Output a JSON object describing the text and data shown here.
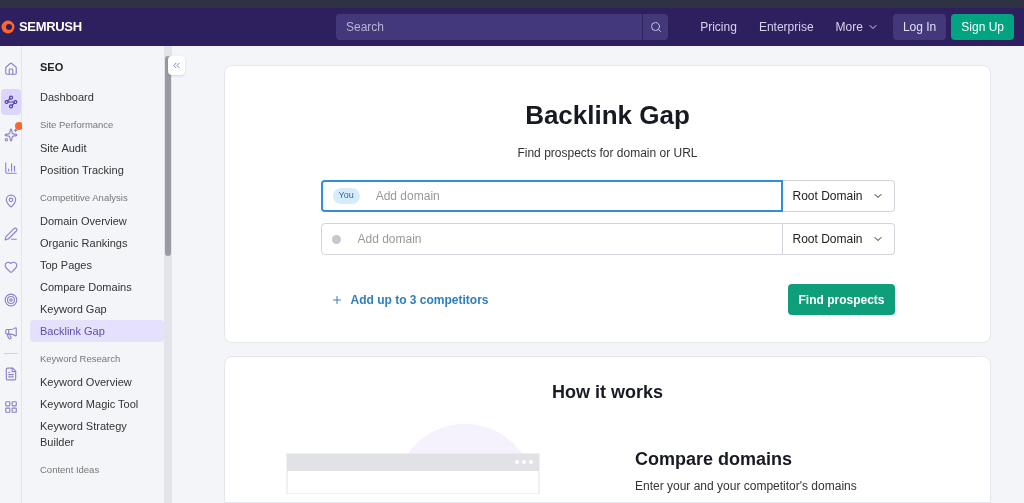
{
  "header": {
    "logo": "SEMRUSH",
    "search": {
      "placeholder": "Search"
    },
    "nav": [
      {
        "label": "Pricing",
        "kind": "link"
      },
      {
        "label": "Enterprise",
        "kind": "link"
      },
      {
        "label": "More",
        "kind": "dropdown"
      }
    ],
    "login": "Log In",
    "signup": "Sign Up"
  },
  "rail": [
    {
      "kind": "home",
      "selected": false
    },
    {
      "kind": "seo",
      "selected": true
    },
    {
      "kind": "sparkle",
      "selected": false,
      "badge": true
    },
    {
      "kind": "chart",
      "selected": false
    },
    {
      "kind": "pin",
      "selected": false
    },
    {
      "kind": "pen",
      "selected": false
    },
    {
      "kind": "heart",
      "selected": false
    },
    {
      "kind": "target",
      "selected": false
    },
    {
      "kind": "megaphone",
      "selected": false
    },
    {
      "kind": "divider"
    },
    {
      "kind": "doc",
      "selected": false
    },
    {
      "kind": "grid",
      "selected": false
    }
  ],
  "sidebar": {
    "title": "SEO",
    "sections": [
      {
        "items": [
          {
            "label": "Dashboard",
            "selected": false
          }
        ]
      },
      {
        "heading": "Site Performance",
        "items": [
          {
            "label": "Site Audit",
            "selected": false
          },
          {
            "label": "Position Tracking",
            "selected": false
          }
        ]
      },
      {
        "heading": "Competitive Analysis",
        "items": [
          {
            "label": "Domain Overview",
            "selected": false
          },
          {
            "label": "Organic Rankings",
            "selected": false
          },
          {
            "label": "Top Pages",
            "selected": false
          },
          {
            "label": "Compare Domains",
            "selected": false
          },
          {
            "label": "Keyword Gap",
            "selected": false
          },
          {
            "label": "Backlink Gap",
            "selected": true
          }
        ]
      },
      {
        "heading": "Keyword Research",
        "items": [
          {
            "label": "Keyword Overview",
            "selected": false
          },
          {
            "label": "Keyword Magic Tool",
            "selected": false
          },
          {
            "label": "Keyword Strategy Builder",
            "selected": false
          }
        ]
      },
      {
        "heading": "Content Ideas"
      }
    ]
  },
  "tool": {
    "title": "Backlink Gap",
    "subtitle": "Find prospects for domain or URL",
    "rows": [
      {
        "kind": "you",
        "badge": "You",
        "placeholder": "Add domain",
        "focused": true,
        "scope": "Root Domain"
      },
      {
        "kind": "competitor",
        "placeholder": "Add domain",
        "focused": false,
        "scope": "Root Domain"
      }
    ],
    "add_link": "Add up to 3 competitors",
    "button": "Find prospects"
  },
  "how": {
    "title": "How it works",
    "feature_title": "Compare domains",
    "feature_text": "Enter your and your competitor's domains"
  }
}
